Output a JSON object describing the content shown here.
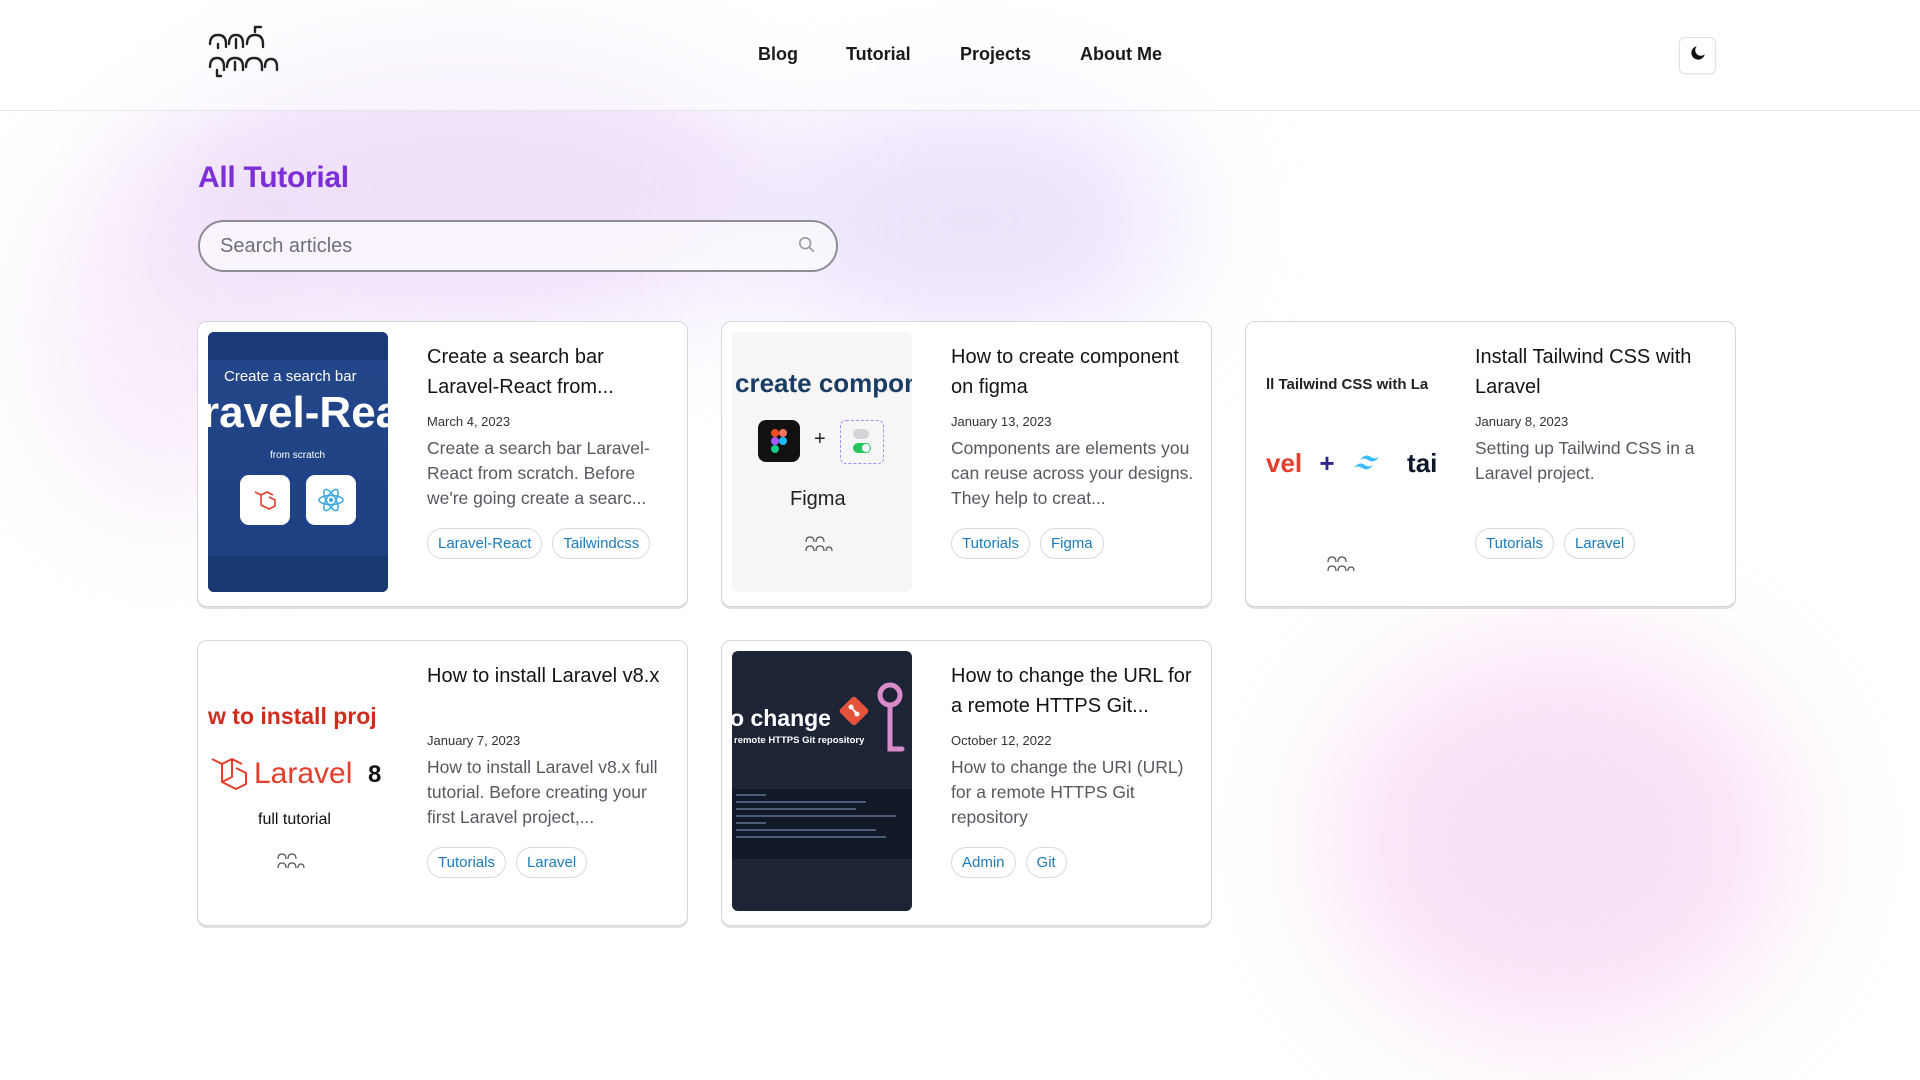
{
  "brand": {
    "logo_alt": "ណាត សុផាត"
  },
  "nav": {
    "items": [
      "Blog",
      "Tutorial",
      "Projects",
      "About Me"
    ]
  },
  "theme_toggle": {
    "icon": "moon-icon"
  },
  "page": {
    "title": "All Tutorial"
  },
  "search": {
    "placeholder": "Search articles",
    "value": "",
    "icon": "search-icon"
  },
  "articles": [
    {
      "title": "Create a search bar Laravel-React from...",
      "date": "March 4, 2023",
      "excerpt": "Create a search bar Laravel-React from scratch. Before we're going create a searc...",
      "tags": [
        "Laravel-React",
        "Tailwindcss"
      ],
      "thumbnail": {
        "small": "Create a search bar",
        "big": "ravel-Rea",
        "sub": "from scratch"
      }
    },
    {
      "title": "How to create component on figma",
      "date": "January 13, 2023",
      "excerpt": "Components are elements you can reuse across your designs. They help to creat...",
      "tags": [
        "Tutorials",
        "Figma"
      ],
      "thumbnail": {
        "big": "create compon",
        "label": "Figma"
      }
    },
    {
      "title": "Install Tailwind CSS with Laravel",
      "date": "January 8, 2023",
      "excerpt": "Setting up Tailwind CSS in a Laravel project.",
      "tags": [
        "Tutorials",
        "Laravel"
      ],
      "thumbnail": {
        "small": "ll Tailwind CSS with La",
        "big_left": "vel",
        "big_plus": "+",
        "big_right": "tai"
      }
    },
    {
      "title": "How to install Laravel v8.x",
      "date": "January 7, 2023",
      "excerpt": "How to install Laravel v8.x full tutorial. Before creating your first Laravel project,...",
      "tags": [
        "Tutorials",
        "Laravel"
      ],
      "thumbnail": {
        "small": "w to install proj",
        "big": "Laravel",
        "num": "8",
        "full": "full tutorial"
      }
    },
    {
      "title": "How to change the URL for a remote HTTPS Git...",
      "date": "October 12, 2022",
      "excerpt": "How to change the URI (URL) for a remote HTTPS Git repository",
      "tags": [
        "Admin",
        "Git"
      ],
      "thumbnail": {
        "big": "o change",
        "sub": "remote HTTPS Git repository"
      }
    }
  ],
  "colors": {
    "accent": "#7c2fd6",
    "tag_text": "#1e7bb8",
    "laravel_red": "#e53c2b",
    "tailwind_cyan": "#38bdf8"
  }
}
